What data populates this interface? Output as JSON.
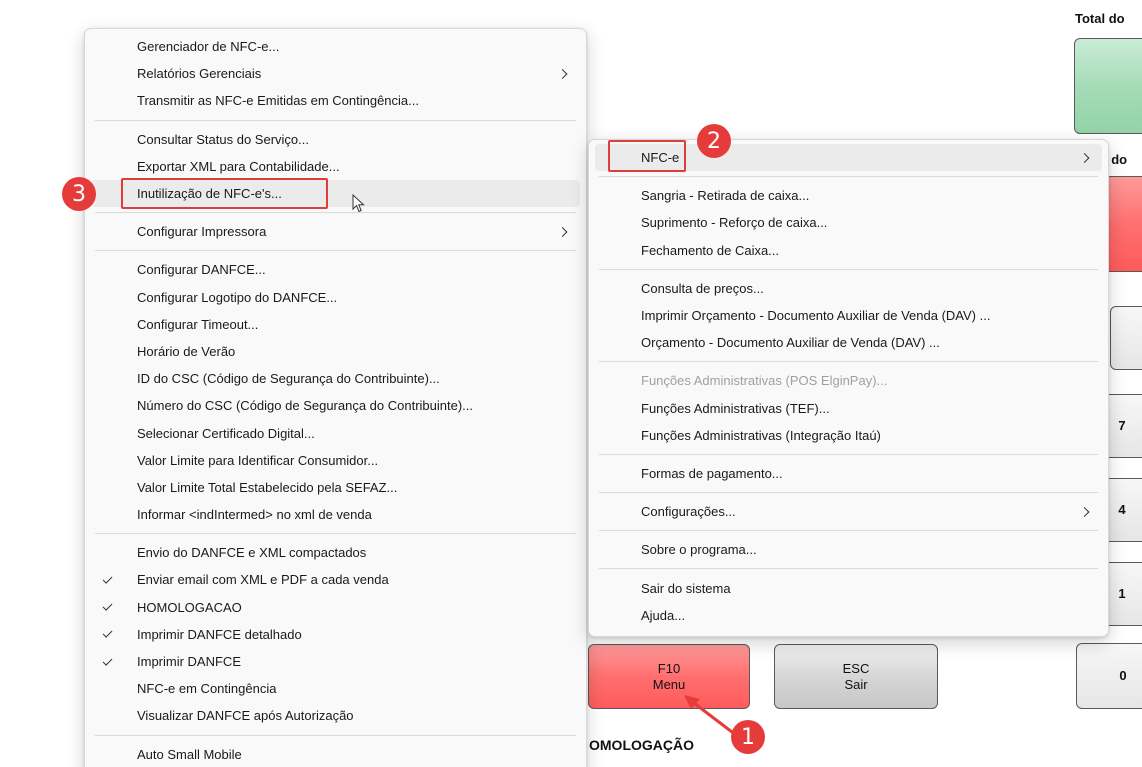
{
  "background": {
    "total_label_1": "Total do",
    "total_label_2": "l do",
    "homologacao_label": "OMOLOGAÇÃO",
    "keys": {
      "f10_key": "F10",
      "f10_label": "Menu",
      "esc_key": "ESC",
      "esc_label": "Sair",
      "num_7": "7",
      "num_4": "4",
      "num_1": "1",
      "num_0": "0"
    },
    "colors": {
      "menu_button": "#ff6f6f",
      "gray_button": "#d6d6d6",
      "total_box": "#a6dcb8"
    }
  },
  "main_menu": {
    "items": [
      {
        "label": "Gerenciador de NFC-e..."
      },
      {
        "label": "Relatórios Gerenciais",
        "submenu": true
      },
      {
        "label": "Transmitir as NFC-e Emitidas em Contingência..."
      },
      {
        "label": "Consultar Status do Serviço..."
      },
      {
        "label": "Exportar XML para Contabilidade..."
      },
      {
        "label": "Inutilização de NFC-e's...",
        "hover": true
      },
      {
        "label": "Configurar Impressora",
        "submenu": true
      },
      {
        "label": "Configurar DANFCE..."
      },
      {
        "label": "Configurar Logotipo do DANFCE..."
      },
      {
        "label": "Configurar Timeout..."
      },
      {
        "label": "Horário de Verão"
      },
      {
        "label": "ID do CSC (Código de Segurança do Contribuinte)..."
      },
      {
        "label": "Número do CSC (Código de Segurança do Contribuinte)..."
      },
      {
        "label": "Selecionar Certificado Digital..."
      },
      {
        "label": "Valor Limite para Identificar Consumidor..."
      },
      {
        "label": "Valor Limite Total Estabelecido pela SEFAZ..."
      },
      {
        "label": "Informar <indIntermed> no xml de venda"
      },
      {
        "label": "Envio do DANFCE e XML compactados"
      },
      {
        "label": "Enviar email com XML e PDF a cada venda",
        "checked": true
      },
      {
        "label": "HOMOLOGACAO",
        "checked": true
      },
      {
        "label": "Imprimir DANFCE detalhado",
        "checked": true
      },
      {
        "label": "Imprimir DANFCE",
        "checked": true
      },
      {
        "label": "NFC-e em Contingência"
      },
      {
        "label": "Visualizar DANFCE após Autorização"
      },
      {
        "label": "Auto Small Mobile"
      }
    ]
  },
  "sub_menu": {
    "items": [
      {
        "label": "NFC-e",
        "submenu": true,
        "hover": true
      },
      {
        "label": "Sangria - Retirada de caixa..."
      },
      {
        "label": "Suprimento - Reforço de caixa..."
      },
      {
        "label": "Fechamento de Caixa..."
      },
      {
        "label": "Consulta de preços..."
      },
      {
        "label": "Imprimir Orçamento - Documento Auxiliar de Venda (DAV) ..."
      },
      {
        "label": "Orçamento - Documento Auxiliar de Venda (DAV) ..."
      },
      {
        "label": "Funções Administrativas (POS ElginPay)...",
        "disabled": true
      },
      {
        "label": "Funções Administrativas (TEF)..."
      },
      {
        "label": "Funções Administrativas (Integração Itaú)"
      },
      {
        "label": "Formas de pagamento..."
      },
      {
        "label": "Configurações...",
        "submenu": true
      },
      {
        "label": "Sobre o programa..."
      },
      {
        "label": "Sair do sistema"
      },
      {
        "label": "Ajuda..."
      }
    ]
  },
  "annotations": {
    "step_1": "1",
    "step_2": "2",
    "step_3": "3",
    "color": "#e63b3b"
  }
}
